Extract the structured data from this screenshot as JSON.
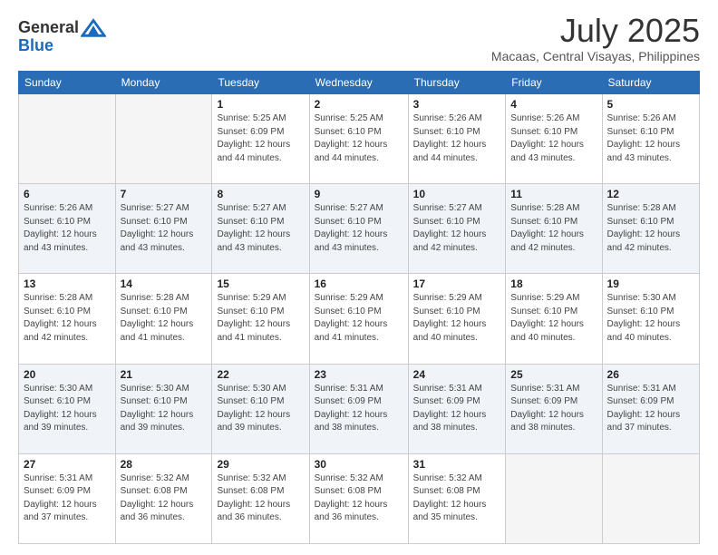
{
  "logo": {
    "line1": "General",
    "line2": "Blue"
  },
  "header": {
    "month_year": "July 2025",
    "location": "Macaas, Central Visayas, Philippines"
  },
  "days_of_week": [
    "Sunday",
    "Monday",
    "Tuesday",
    "Wednesday",
    "Thursday",
    "Friday",
    "Saturday"
  ],
  "weeks": [
    [
      {
        "day": "",
        "info": ""
      },
      {
        "day": "",
        "info": ""
      },
      {
        "day": "1",
        "info": "Sunrise: 5:25 AM\nSunset: 6:09 PM\nDaylight: 12 hours and 44 minutes."
      },
      {
        "day": "2",
        "info": "Sunrise: 5:25 AM\nSunset: 6:10 PM\nDaylight: 12 hours and 44 minutes."
      },
      {
        "day": "3",
        "info": "Sunrise: 5:26 AM\nSunset: 6:10 PM\nDaylight: 12 hours and 44 minutes."
      },
      {
        "day": "4",
        "info": "Sunrise: 5:26 AM\nSunset: 6:10 PM\nDaylight: 12 hours and 43 minutes."
      },
      {
        "day": "5",
        "info": "Sunrise: 5:26 AM\nSunset: 6:10 PM\nDaylight: 12 hours and 43 minutes."
      }
    ],
    [
      {
        "day": "6",
        "info": "Sunrise: 5:26 AM\nSunset: 6:10 PM\nDaylight: 12 hours and 43 minutes."
      },
      {
        "day": "7",
        "info": "Sunrise: 5:27 AM\nSunset: 6:10 PM\nDaylight: 12 hours and 43 minutes."
      },
      {
        "day": "8",
        "info": "Sunrise: 5:27 AM\nSunset: 6:10 PM\nDaylight: 12 hours and 43 minutes."
      },
      {
        "day": "9",
        "info": "Sunrise: 5:27 AM\nSunset: 6:10 PM\nDaylight: 12 hours and 43 minutes."
      },
      {
        "day": "10",
        "info": "Sunrise: 5:27 AM\nSunset: 6:10 PM\nDaylight: 12 hours and 42 minutes."
      },
      {
        "day": "11",
        "info": "Sunrise: 5:28 AM\nSunset: 6:10 PM\nDaylight: 12 hours and 42 minutes."
      },
      {
        "day": "12",
        "info": "Sunrise: 5:28 AM\nSunset: 6:10 PM\nDaylight: 12 hours and 42 minutes."
      }
    ],
    [
      {
        "day": "13",
        "info": "Sunrise: 5:28 AM\nSunset: 6:10 PM\nDaylight: 12 hours and 42 minutes."
      },
      {
        "day": "14",
        "info": "Sunrise: 5:28 AM\nSunset: 6:10 PM\nDaylight: 12 hours and 41 minutes."
      },
      {
        "day": "15",
        "info": "Sunrise: 5:29 AM\nSunset: 6:10 PM\nDaylight: 12 hours and 41 minutes."
      },
      {
        "day": "16",
        "info": "Sunrise: 5:29 AM\nSunset: 6:10 PM\nDaylight: 12 hours and 41 minutes."
      },
      {
        "day": "17",
        "info": "Sunrise: 5:29 AM\nSunset: 6:10 PM\nDaylight: 12 hours and 40 minutes."
      },
      {
        "day": "18",
        "info": "Sunrise: 5:29 AM\nSunset: 6:10 PM\nDaylight: 12 hours and 40 minutes."
      },
      {
        "day": "19",
        "info": "Sunrise: 5:30 AM\nSunset: 6:10 PM\nDaylight: 12 hours and 40 minutes."
      }
    ],
    [
      {
        "day": "20",
        "info": "Sunrise: 5:30 AM\nSunset: 6:10 PM\nDaylight: 12 hours and 39 minutes."
      },
      {
        "day": "21",
        "info": "Sunrise: 5:30 AM\nSunset: 6:10 PM\nDaylight: 12 hours and 39 minutes."
      },
      {
        "day": "22",
        "info": "Sunrise: 5:30 AM\nSunset: 6:10 PM\nDaylight: 12 hours and 39 minutes."
      },
      {
        "day": "23",
        "info": "Sunrise: 5:31 AM\nSunset: 6:09 PM\nDaylight: 12 hours and 38 minutes."
      },
      {
        "day": "24",
        "info": "Sunrise: 5:31 AM\nSunset: 6:09 PM\nDaylight: 12 hours and 38 minutes."
      },
      {
        "day": "25",
        "info": "Sunrise: 5:31 AM\nSunset: 6:09 PM\nDaylight: 12 hours and 38 minutes."
      },
      {
        "day": "26",
        "info": "Sunrise: 5:31 AM\nSunset: 6:09 PM\nDaylight: 12 hours and 37 minutes."
      }
    ],
    [
      {
        "day": "27",
        "info": "Sunrise: 5:31 AM\nSunset: 6:09 PM\nDaylight: 12 hours and 37 minutes."
      },
      {
        "day": "28",
        "info": "Sunrise: 5:32 AM\nSunset: 6:08 PM\nDaylight: 12 hours and 36 minutes."
      },
      {
        "day": "29",
        "info": "Sunrise: 5:32 AM\nSunset: 6:08 PM\nDaylight: 12 hours and 36 minutes."
      },
      {
        "day": "30",
        "info": "Sunrise: 5:32 AM\nSunset: 6:08 PM\nDaylight: 12 hours and 36 minutes."
      },
      {
        "day": "31",
        "info": "Sunrise: 5:32 AM\nSunset: 6:08 PM\nDaylight: 12 hours and 35 minutes."
      },
      {
        "day": "",
        "info": ""
      },
      {
        "day": "",
        "info": ""
      }
    ]
  ]
}
